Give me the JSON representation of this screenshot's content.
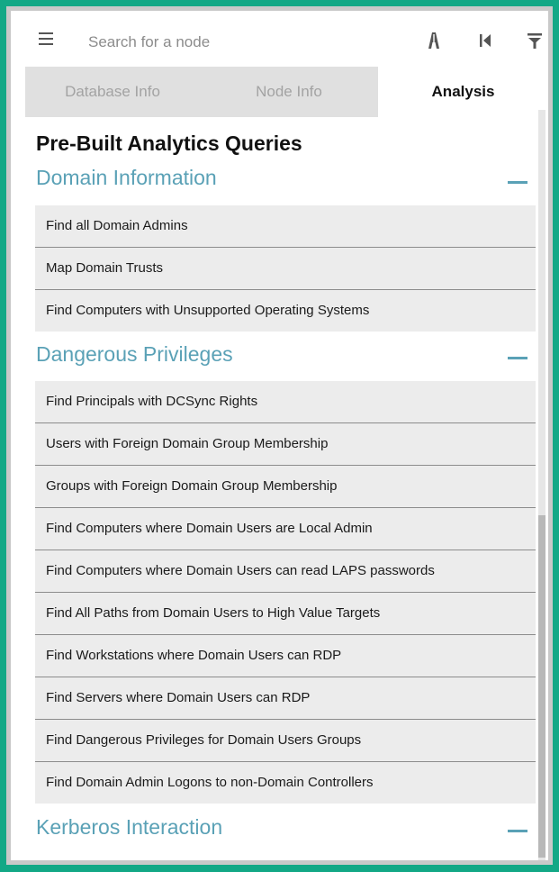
{
  "search": {
    "placeholder": "Search for a node"
  },
  "toolbar": {
    "menu_icon": "hamburger-menu-icon",
    "icons": [
      "pathfinding-icon",
      "back-icon",
      "filter-icon"
    ]
  },
  "tabs": [
    {
      "label": "Database Info",
      "active": false
    },
    {
      "label": "Node Info",
      "active": false
    },
    {
      "label": "Analysis",
      "active": true
    }
  ],
  "analysis": {
    "heading": "Pre-Built Analytics Queries",
    "sections": [
      {
        "title": "Domain Information",
        "queries": [
          "Find all Domain Admins",
          "Map Domain Trusts",
          "Find Computers with Unsupported Operating Systems"
        ]
      },
      {
        "title": "Dangerous Privileges",
        "queries": [
          "Find Principals with DCSync Rights",
          "Users with Foreign Domain Group Membership",
          "Groups with Foreign Domain Group Membership",
          "Find Computers where Domain Users are Local Admin",
          "Find Computers where Domain Users can read LAPS passwords",
          "Find All Paths from Domain Users to High Value Targets",
          "Find Workstations where Domain Users can RDP",
          "Find Servers where Domain Users can RDP",
          "Find Dangerous Privileges for Domain Users Groups",
          "Find Domain Admin Logons to non-Domain Controllers"
        ]
      },
      {
        "title": "Kerberos Interaction",
        "queries": []
      }
    ]
  },
  "colors": {
    "accent": "#5aa1b6",
    "border": "#13a886",
    "row_bg": "#ececec"
  }
}
